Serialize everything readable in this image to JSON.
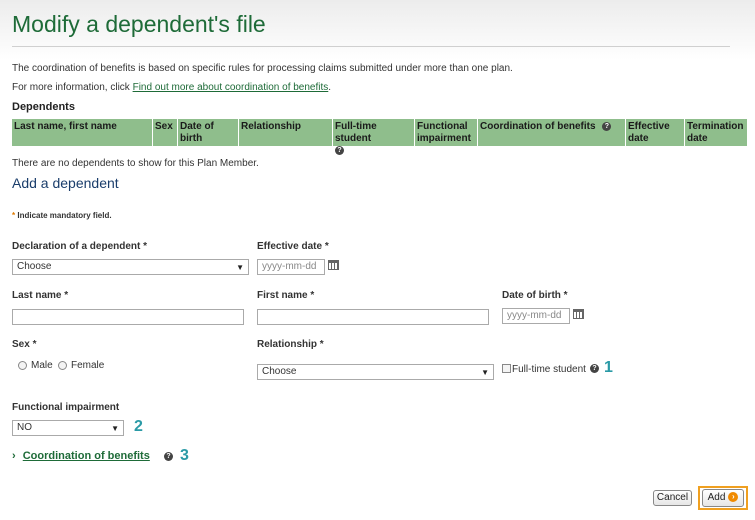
{
  "page": {
    "title": "Modify a dependent's file",
    "intro_text": "The coordination of benefits is based on specific rules for processing claims submitted under more than one plan.",
    "more_info_prefix": "For more information, click ",
    "more_info_link": "Find out more about coordination of benefits",
    "more_info_suffix": "."
  },
  "dependents": {
    "heading": "Dependents",
    "columns": [
      "Last name, first name",
      "Sex",
      "Date of birth",
      "Relationship",
      "Full-time student",
      "Functional impairment",
      "Coordination of benefits",
      "Effective date",
      "Termination date"
    ],
    "empty_text": "There are no dependents to show for this Plan Member."
  },
  "form": {
    "heading": "Add a dependent",
    "mandatory_star": "*",
    "mandatory_note": " Indicate mandatory field.",
    "required_mark": "*",
    "declaration": {
      "label": "Declaration of a dependent",
      "value": "Choose"
    },
    "effective_date": {
      "label": "Effective date",
      "placeholder": "yyyy-mm-dd"
    },
    "last_name": {
      "label": "Last name",
      "value": ""
    },
    "first_name": {
      "label": "First name",
      "value": ""
    },
    "date_of_birth": {
      "label": "Date of birth",
      "placeholder": "yyyy-mm-dd"
    },
    "sex": {
      "label": "Sex",
      "options": [
        "Male",
        "Female"
      ]
    },
    "relationship": {
      "label": "Relationship",
      "value": "Choose"
    },
    "full_time_student": {
      "label": "Full-time student"
    },
    "functional_impairment": {
      "label": "Functional impairment",
      "value": "NO"
    },
    "coordination": {
      "chevron": "›",
      "label": "Coordination of benefits"
    },
    "help_glyph": "?",
    "markers": [
      "1",
      "2",
      "3"
    ]
  },
  "actions": {
    "cancel": "Cancel",
    "add": "Add"
  },
  "colors": {
    "title_green": "#1e6b38",
    "table_header": "#8fbe8c",
    "accent_orange": "#f0a020",
    "marker_teal": "#2a9aa6"
  },
  "icons": {
    "help": "question-circle-icon",
    "calendar": "calendar-icon",
    "add_arrow": "arrow-right-circle-icon"
  }
}
